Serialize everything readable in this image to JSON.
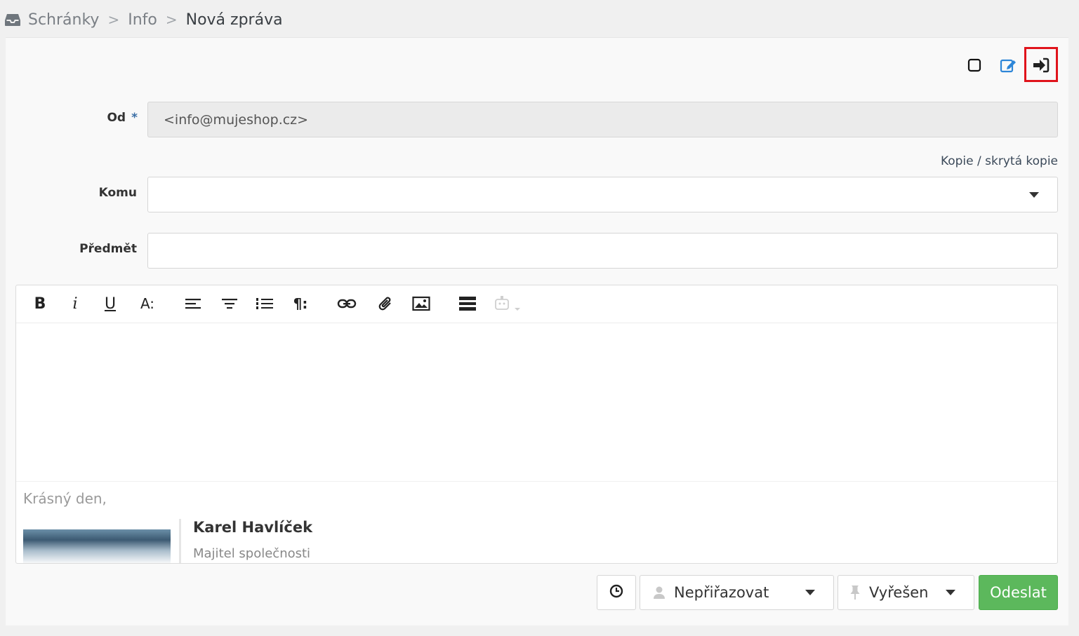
{
  "breadcrumb": {
    "items": [
      "Schránky",
      "Info",
      "Nová zpráva"
    ],
    "separator": ">"
  },
  "toolbar_icons": {
    "checkbox": "square-outline-icon",
    "edit": "edit-icon",
    "signin": "sign-in-icon"
  },
  "form": {
    "from_label": "Od",
    "required_mark": "*",
    "from_value": "<info@mujeshop.cz>",
    "cc_link": "Kopie / skrytá kopie",
    "to_label": "Komu",
    "to_value": "",
    "subject_label": "Předmět",
    "subject_value": ""
  },
  "editor_toolbar": [
    {
      "name": "bold-icon",
      "glyph": "B"
    },
    {
      "name": "italic-icon",
      "glyph": "i"
    },
    {
      "name": "underline-icon",
      "glyph": "U"
    },
    {
      "name": "font-size-icon",
      "glyph": "A:"
    },
    {
      "name": "align-left-icon"
    },
    {
      "name": "align-center-icon"
    },
    {
      "name": "ordered-list-icon"
    },
    {
      "name": "paragraph-icon",
      "glyph": "¶:"
    },
    {
      "name": "link-icon"
    },
    {
      "name": "attachment-icon"
    },
    {
      "name": "image-icon"
    },
    {
      "name": "template-icon"
    },
    {
      "name": "robot-icon"
    }
  ],
  "signature": {
    "greeting": "Krásný den,",
    "name": "Karel Havlíček",
    "role": "Majitel společnosti"
  },
  "footer": {
    "assign_label": "Nepřiřazovat",
    "status_label": "Vyřešen",
    "send_label": "Odeslat"
  },
  "colors": {
    "accent": "#3a7bd5",
    "send": "#5cb85c",
    "highlight": "#e0141c"
  }
}
